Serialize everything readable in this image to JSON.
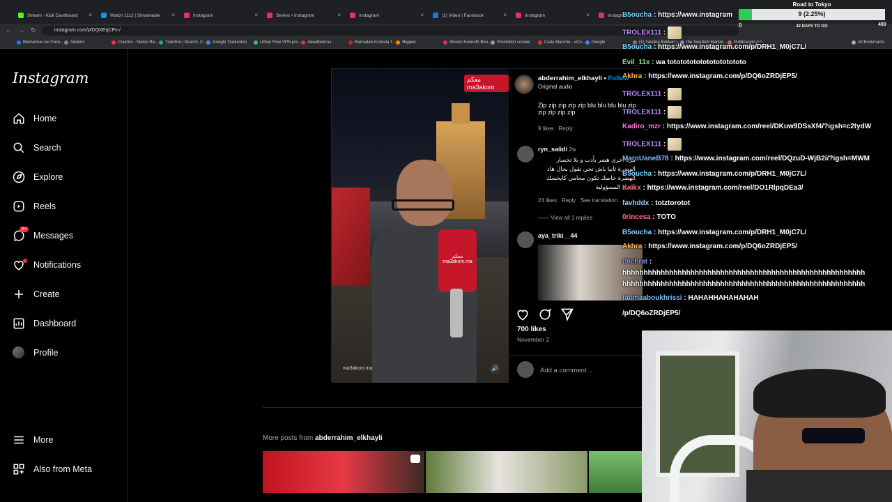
{
  "browser": {
    "tabs": [
      {
        "label": "Stream - Kick Dashboard",
        "color": "#53fc18"
      },
      {
        "label": "Watch 1112 | Streamable",
        "color": "#0f90fa"
      },
      {
        "label": "Instagram",
        "color": "#e1306c"
      },
      {
        "label": "Stories • Instagram",
        "color": "#e1306c"
      },
      {
        "label": "Instagram",
        "color": "#e1306c"
      },
      {
        "label": "(2) Video | Facebook",
        "color": "#1877f2"
      },
      {
        "label": "Instagram",
        "color": "#e1306c"
      },
      {
        "label": "Instagram",
        "color": "#e1306c"
      }
    ],
    "url": "instagram.com/p/DQXErjCPs-/",
    "bookmarks": [
      "Bienvenue sur Face...",
      "Addons",
      "Courrier - Mateo Ra...",
      "Trainline | Search, C...",
      "Google Traduction",
      "Urban Free VPN pro...",
      "Авиабилеты",
      "Ramadan Al Aoula T...",
      "Яндекс",
      "Steven Kenneth Bon...",
      "Promotion sociale",
      "Carte blanche - «Co...",
      "Google",
      "(1) Yassine Bekkar! |...",
      "the Swedish Market...",
      "Publicación n.º...",
      "All Bookmarks"
    ]
  },
  "instagram": {
    "logo": "Instagram",
    "nav": [
      {
        "label": "Home",
        "icon": "home-icon"
      },
      {
        "label": "Search",
        "icon": "search-icon"
      },
      {
        "label": "Explore",
        "icon": "compass-icon"
      },
      {
        "label": "Reels",
        "icon": "reels-icon"
      },
      {
        "label": "Messages",
        "icon": "messenger-icon",
        "badge": "9+"
      },
      {
        "label": "Notifications",
        "icon": "heart-icon"
      },
      {
        "label": "Create",
        "icon": "plus-icon"
      },
      {
        "label": "Dashboard",
        "icon": "dashboard-icon"
      },
      {
        "label": "Profile",
        "icon": "avatar-icon"
      }
    ],
    "nav_bottom": [
      {
        "label": "More",
        "icon": "menu-icon"
      },
      {
        "label": "Also from Meta",
        "icon": "meta-icon"
      }
    ],
    "post": {
      "video_logo": "معكم ma3akom",
      "mic_text": "معكم ma3akom.ma",
      "watermark": "ma3akom.ma",
      "author": "abderrahim_elkhayli",
      "follow": "Follow",
      "audio": "Original audio",
      "comments": [
        {
          "user": "",
          "text": "Zip zip zip zip zip blu blu blu blu zip zip zip zip zip",
          "likes": "9 likes",
          "reply": "Reply"
        },
        {
          "user": "ryn_saiidi",
          "time": "2w",
          "text": "مرة أخرى هضر بأدب و بلا تخسار الهضرة ثانيا باش تجي تقول بحال هاد الهضرة خاصك تكون محامي كايخسك تحمل المسؤولية",
          "likes": "24 likes",
          "reply": "Reply",
          "translate": "See translation",
          "view_replies": "View all 1 replies"
        },
        {
          "user": "aya_triki__44",
          "text": ""
        }
      ],
      "likes": "700 likes",
      "date": "November 2",
      "add_comment": "Add a comment..."
    },
    "more_posts_prefix": "More posts from ",
    "more_posts_user": "abderrahim_elkhayli"
  },
  "stream": {
    "goal_title": "Road to Tokyo",
    "goal_value": "9 (2.25%)",
    "goal_fraction": 0.0225,
    "goal_min": "0",
    "goal_max": "400",
    "goal_days": "42 DAYS TO GO",
    "chat": [
      {
        "user": "B5oucha",
        "color": "#7cd4ff",
        "text": "https://www.instagram",
        "emote": false
      },
      {
        "user": "TROLEX111",
        "color": "#b98bff",
        "text": "",
        "emote": true
      },
      {
        "user": "B5oucha",
        "color": "#7cd4ff",
        "text": "https://www.instagram.com/p/DRH1_M0jC7L/",
        "emote": false
      },
      {
        "user": "Evil_11x",
        "color": "#8fe38f",
        "text": "wa totototototototototototo",
        "emote": false
      },
      {
        "user": "Akhra",
        "color": "#ffb347",
        "text": "https://www.instagram.com/p/DQ6oZRDjEP5/",
        "emote": false
      },
      {
        "user": "TROLEX111",
        "color": "#b98bff",
        "text": "",
        "emote": true
      },
      {
        "user": "TROLEX111",
        "color": "#b98bff",
        "text": "",
        "emote": true
      },
      {
        "user": "Kadiro_mzr",
        "color": "#ff7bd0",
        "text": "https://www.instagram.com/reel/DKuw9DSsXf4/?igsh=c2tydW",
        "emote": false
      },
      {
        "user": "TROLEX111",
        "color": "#b98bff",
        "text": "",
        "emote": true
      },
      {
        "user": "MaroUaneB78",
        "color": "#8ab4ff",
        "text": "https://www.instagram.com/reel/DQzuD-WjB2i/?igsh=MWM",
        "emote": false
      },
      {
        "user": "B5oucha",
        "color": "#7cd4ff",
        "text": "https://www.instagram.com/p/DRH1_M0jC7L/",
        "emote": false
      },
      {
        "user": "Kxikx",
        "color": "#ff6b6b",
        "text": "https://www.instagram.com/reel/DO1RlpqDEa3/",
        "emote": false
      },
      {
        "user": "favhddx",
        "color": "#9fd1ff",
        "text": "totztorotot",
        "emote": false
      },
      {
        "user": "0rincesa",
        "color": "#ff6b8a",
        "text": "TOTO",
        "emote": false
      },
      {
        "user": "B5oucha",
        "color": "#7cd4ff",
        "text": "https://www.instagram.com/p/DRH1_M0jC7L/",
        "emote": false
      },
      {
        "user": "Akhra",
        "color": "#ffb347",
        "text": "https://www.instagram.com/p/DQ6oZRDjEP5/",
        "emote": false
      },
      {
        "user": "t9ichrat",
        "color": "#7d8cff",
        "text": "",
        "emote": false
      },
      {
        "user": "",
        "color": "#ffffff",
        "text": "hhhhhhhhhhhhhhhhhhhhhhhhhhhhhhhhhhhhhhhhhhhhhhhhhhhhhhhhh",
        "emote": false
      },
      {
        "user": "",
        "color": "#ffffff",
        "text": "hhhhhhhhhhhhhhhhhhhhhhhhhhhhhhhhhhhhhhhhhhhhhhhhhhhhhhhhh",
        "emote": false
      },
      {
        "user": "fatimaaboukhrissi",
        "color": "#7fb7ff",
        "text": "HAHAHHAHAHAHAH",
        "emote": false
      },
      {
        "user": "",
        "color": "#ffffff",
        "text": "/p/DQ6oZRDjEP5/",
        "emote": false
      }
    ]
  }
}
